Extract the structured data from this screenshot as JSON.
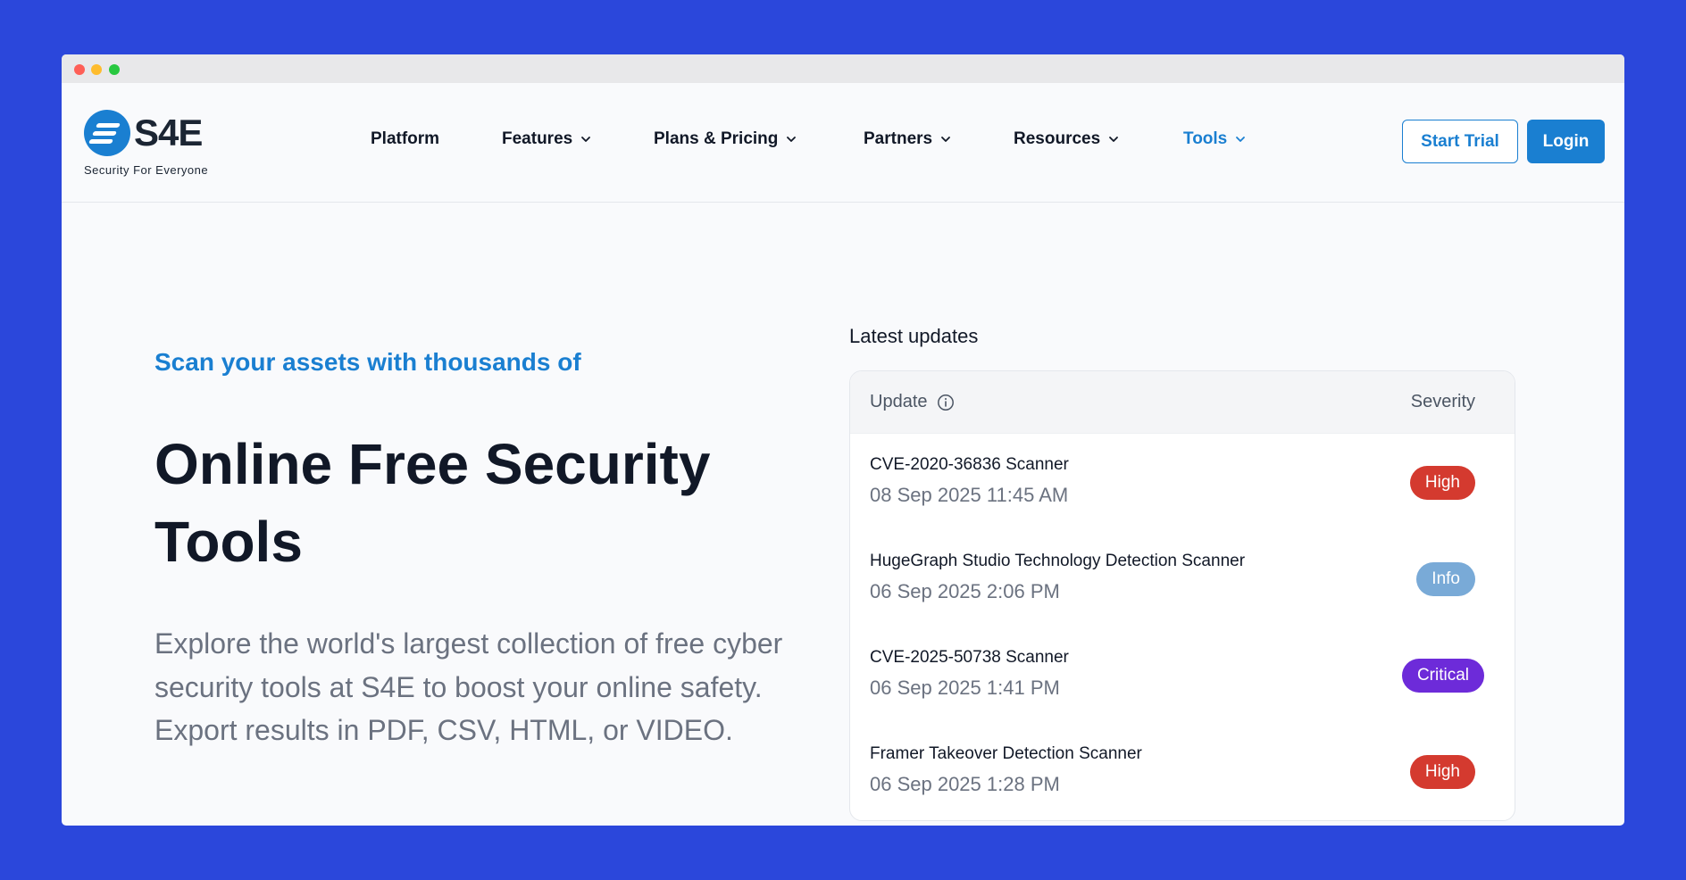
{
  "brand": {
    "name": "S4E",
    "tagline": "Security For Everyone",
    "accent": "#1a7fd1"
  },
  "nav": {
    "items": [
      {
        "label": "Platform",
        "has_dropdown": false,
        "active": false
      },
      {
        "label": "Features",
        "has_dropdown": true,
        "active": false
      },
      {
        "label": "Plans & Pricing",
        "has_dropdown": true,
        "active": false
      },
      {
        "label": "Partners",
        "has_dropdown": true,
        "active": false
      },
      {
        "label": "Resources",
        "has_dropdown": true,
        "active": false
      },
      {
        "label": "Tools",
        "has_dropdown": true,
        "active": true
      }
    ],
    "start_trial": "Start Trial",
    "login": "Login"
  },
  "hero": {
    "eyebrow": "Scan your assets with thousands of",
    "title": "Online Free Security Tools",
    "description": "Explore the world's largest collection of free cyber security tools at S4E to boost your online safety. Export results in PDF, CSV, HTML, or VIDEO."
  },
  "updates": {
    "label": "Latest updates",
    "col_update": "Update",
    "col_severity": "Severity",
    "rows": [
      {
        "name": "CVE-2020-36836 Scanner",
        "date": "08 Sep 2025 11:45 AM",
        "severity": "High",
        "color": "#d43a2f"
      },
      {
        "name": "HugeGraph Studio Technology Detection Scanner",
        "date": "06 Sep 2025 2:06 PM",
        "severity": "Info",
        "color": "#79aad7"
      },
      {
        "name": "CVE-2025-50738 Scanner",
        "date": "06 Sep 2025 1:41 PM",
        "severity": "Critical",
        "color": "#6d2bd9"
      },
      {
        "name": "Framer Takeover Detection Scanner",
        "date": "06 Sep 2025 1:28 PM",
        "severity": "High",
        "color": "#d43a2f"
      }
    ]
  }
}
